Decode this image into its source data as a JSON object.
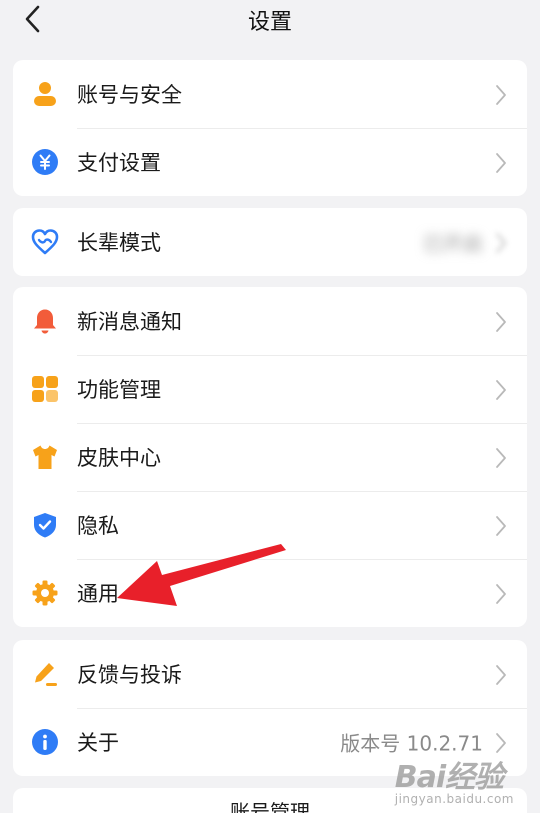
{
  "header": {
    "title": "设置"
  },
  "groups": [
    {
      "items": [
        {
          "label": "账号与安全",
          "icon": "user-icon"
        },
        {
          "label": "支付设置",
          "icon": "yuan-icon"
        }
      ]
    },
    {
      "items": [
        {
          "label": "长辈模式",
          "icon": "heart-icon",
          "value": "已开启"
        }
      ]
    },
    {
      "items": [
        {
          "label": "新消息通知",
          "icon": "bell-icon"
        },
        {
          "label": "功能管理",
          "icon": "grid-icon"
        },
        {
          "label": "皮肤中心",
          "icon": "shirt-icon"
        },
        {
          "label": "隐私",
          "icon": "shield-icon"
        },
        {
          "label": "通用",
          "icon": "gear-icon"
        }
      ]
    },
    {
      "items": [
        {
          "label": "反馈与投诉",
          "icon": "pencil-icon"
        },
        {
          "label": "关于",
          "icon": "info-icon",
          "value": "版本号 10.2.71"
        }
      ]
    }
  ],
  "bottom": {
    "label": "账号管理"
  },
  "watermark": {
    "main": "Bai经验",
    "sub": "jingyan.baidu.com"
  },
  "colors": {
    "accent_blue": "#2f7cf6",
    "accent_orange": "#f7a21a",
    "bell_red": "#f25c3a",
    "annotation_red": "#e8202a"
  }
}
